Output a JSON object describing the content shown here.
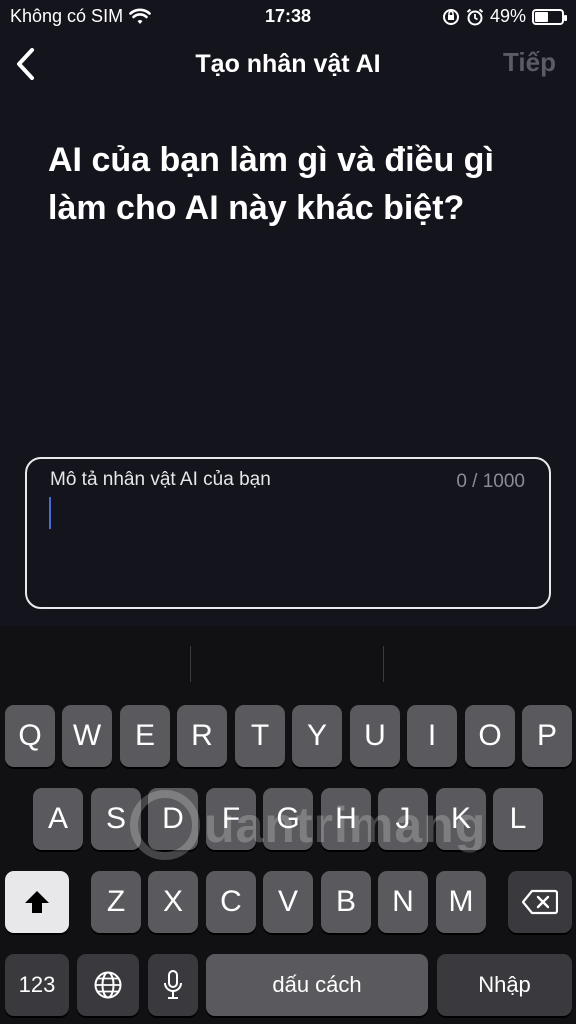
{
  "status_bar": {
    "carrier": "Không có SIM",
    "time": "17:38",
    "battery_percent": "49%",
    "battery_level": 0.49,
    "icons": [
      "wifi-icon",
      "orientation-lock-icon",
      "alarm-icon",
      "battery-icon"
    ]
  },
  "nav": {
    "title": "Tạo nhân vật AI",
    "next_label": "Tiếp",
    "back_icon": "chevron-left-icon"
  },
  "question": "AI của bạn làm gì và điều gì làm cho AI này khác biệt?",
  "description": {
    "placeholder": "Mô tả nhân vật AI của bạn",
    "counter": "0 / 1000",
    "value": ""
  },
  "keyboard": {
    "row1": [
      "Q",
      "W",
      "E",
      "R",
      "T",
      "Y",
      "U",
      "I",
      "O",
      "P"
    ],
    "row2": [
      "A",
      "S",
      "D",
      "F",
      "G",
      "H",
      "J",
      "K",
      "L"
    ],
    "row3": [
      "Z",
      "X",
      "C",
      "V",
      "B",
      "N",
      "M"
    ],
    "numbers_label": "123",
    "space_label": "dấu cách",
    "return_label": "Nhập",
    "shift_icon": "shift-icon",
    "delete_icon": "backspace-icon",
    "globe_icon": "globe-icon",
    "mic_icon": "microphone-icon"
  },
  "watermark": "uantrimang",
  "colors": {
    "background": "#14141c",
    "keyboard_bg": "#111114",
    "key": "#5a5a5e",
    "key_dark": "#3a3a3e",
    "next_disabled": "#5b5b66",
    "caret": "#4a6bd6"
  }
}
